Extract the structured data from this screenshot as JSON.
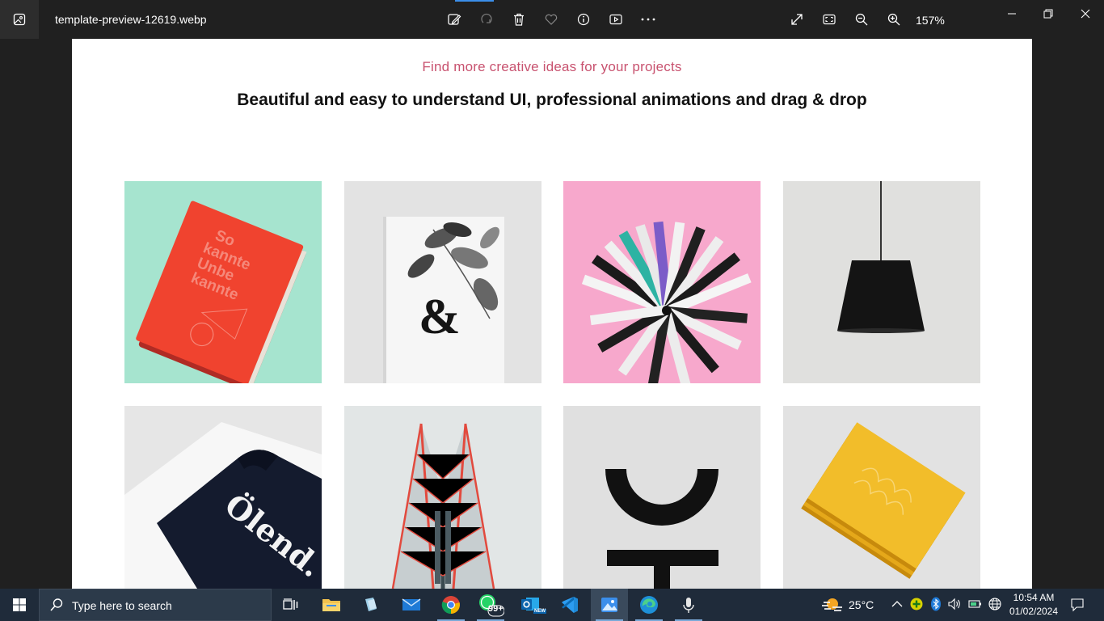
{
  "window": {
    "filename": "template-preview-12619.webp",
    "zoom": "157%"
  },
  "toolbar": {
    "icons": [
      "edit-image-icon",
      "rotate-icon",
      "delete-icon",
      "favorite-icon",
      "info-icon",
      "slideshow-icon",
      "more-icon",
      "fullscreen-icon",
      "fit-to-window-icon",
      "zoom-out-icon",
      "zoom-in-icon"
    ]
  },
  "image": {
    "subtitle": "Find more creative ideas for your projects",
    "headline": "Beautiful and easy to understand UI, professional animations and drag & drop",
    "tiles": [
      {
        "name": "red-book",
        "background": "#a6e4cf",
        "text": [
          "So",
          "kannte",
          "Unbe",
          "kannte"
        ]
      },
      {
        "name": "ampersand-leaves",
        "background": "#e3e3e3",
        "text": "&"
      },
      {
        "name": "color-swatch-fan",
        "background": "#f7a8cc"
      },
      {
        "name": "black-pendant-lamp",
        "background": "#e0e0de"
      },
      {
        "name": "olend-sweater",
        "background": "#e6e6e6",
        "text": "Ölend."
      },
      {
        "name": "building-facade",
        "background": "#e2e6e6"
      },
      {
        "name": "black-letterform",
        "background": "#e0e0e0"
      },
      {
        "name": "yellow-notebooks",
        "background": "#e2e2e2"
      }
    ]
  },
  "taskbar": {
    "search_placeholder": "Type here to search",
    "whatsapp_badge": "99+",
    "outlook_badge": "NEW",
    "weather": "25°C",
    "time": "10:54 AM",
    "date": "01/02/2024"
  },
  "colors": {
    "accent_pink": "#c8526f",
    "titlebar": "#202020",
    "taskbar": "#1f2b3a"
  }
}
